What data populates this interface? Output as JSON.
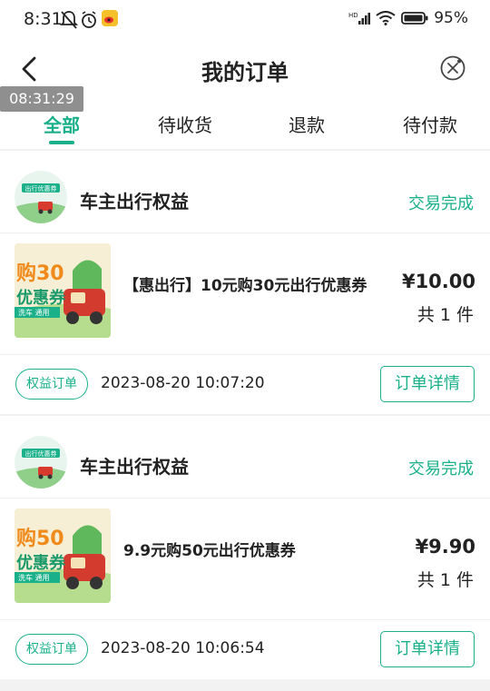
{
  "status_bar": {
    "time": "8:31",
    "battery": "95%"
  },
  "header": {
    "title": "我的订单"
  },
  "timestamp_overlay": "08:31:29",
  "tabs": [
    {
      "label": "全部",
      "active": true
    },
    {
      "label": "待收货",
      "active": false
    },
    {
      "label": "退款",
      "active": false
    },
    {
      "label": "待付款",
      "active": false
    }
  ],
  "orders": [
    {
      "shop_name": "车主出行权益",
      "status": "交易完成",
      "product_name": "【惠出行】10元购30元出行优惠券",
      "price": "¥10.00",
      "quantity": "共 1 件",
      "tag": "权益订单",
      "date": "2023-08-20 10:07:20",
      "detail_button": "订单详情",
      "thumb_text_big": "购30",
      "thumb_text_sub": "优惠券",
      "thumb_text_mini": "洗车  通用"
    },
    {
      "shop_name": "车主出行权益",
      "status": "交易完成",
      "product_name": "9.9元购50元出行优惠券",
      "price": "¥9.90",
      "quantity": "共 1 件",
      "tag": "权益订单",
      "date": "2023-08-20 10:06:54",
      "detail_button": "订单详情",
      "thumb_text_big": "购50",
      "thumb_text_sub": "优惠券",
      "thumb_text_mini": "洗车  通用"
    }
  ],
  "logo_text": "出行优惠券",
  "colors": {
    "accent": "#19b08a",
    "background": "#f2f2f2"
  }
}
